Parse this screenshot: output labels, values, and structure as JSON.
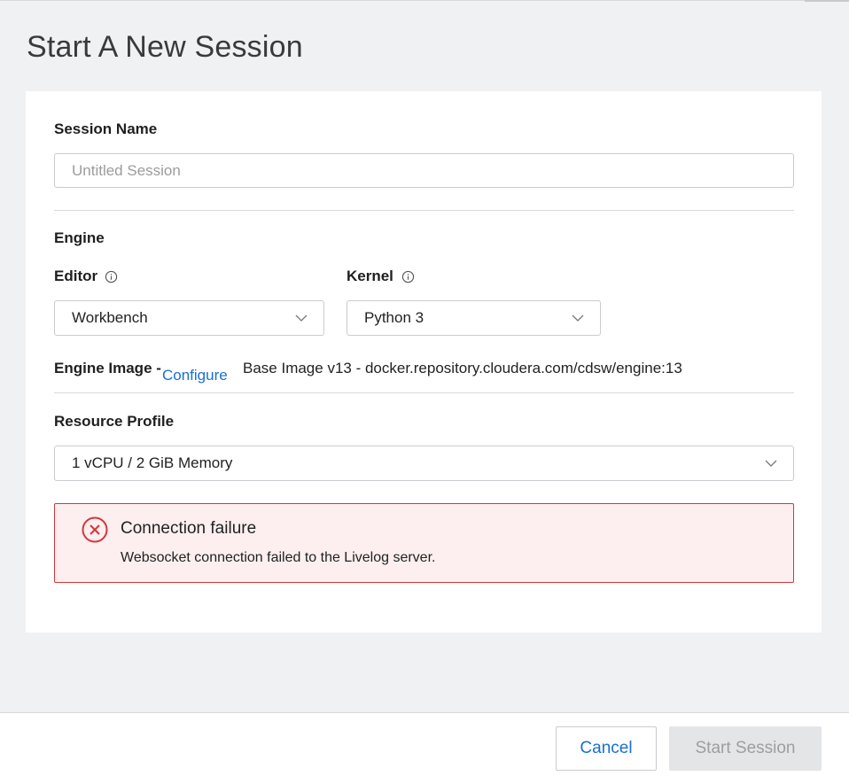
{
  "page": {
    "title": "Start A New Session"
  },
  "form": {
    "session_name_label": "Session Name",
    "session_name_placeholder": "Untitled Session",
    "session_name_value": "",
    "engine_heading": "Engine",
    "editor_label": "Editor",
    "editor_value": "Workbench",
    "kernel_label": "Kernel",
    "kernel_value": "Python 3",
    "engine_image_label": "Engine Image -",
    "engine_image_configure_link": "Configure",
    "engine_image_value": "Base Image v13 - docker.repository.cloudera.com/cdsw/engine:13",
    "resource_profile_label": "Resource Profile",
    "resource_profile_value": "1 vCPU / 2 GiB Memory"
  },
  "alert": {
    "title": "Connection failure",
    "message": "Websocket connection failed to the Livelog server.",
    "icon": "error-circle-x-icon",
    "color": "#d4363a"
  },
  "footer": {
    "cancel_label": "Cancel",
    "start_label": "Start Session"
  },
  "colors": {
    "accent": "#1a6fd1",
    "page_background": "#f0f1f2",
    "error_border": "#d4363a",
    "error_background": "#fdeff0",
    "disabled_button": "#e3e5e7"
  }
}
